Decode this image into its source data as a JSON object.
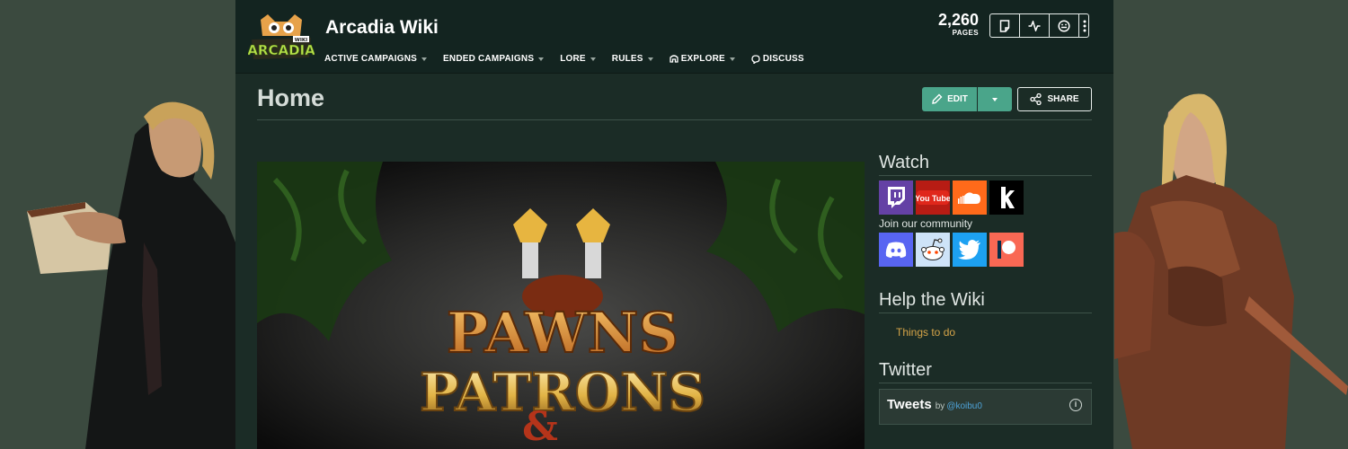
{
  "site": {
    "title": "Arcadia Wiki",
    "logo_text": "ARCADIA",
    "logo_badge": "WIKI",
    "pages_count": "2,260",
    "pages_label": "PAGES"
  },
  "nav": {
    "items": [
      {
        "label": "ACTIVE CAMPAIGNS",
        "icon": null
      },
      {
        "label": "ENDED CAMPAIGNS",
        "icon": null
      },
      {
        "label": "LORE",
        "icon": null
      },
      {
        "label": "RULES",
        "icon": null
      },
      {
        "label": "EXPLORE",
        "icon": "explore-icon"
      },
      {
        "label": "DISCUSS",
        "icon": "discuss-icon"
      }
    ]
  },
  "toolbar": {
    "icons": [
      "new-page-icon",
      "activity-icon",
      "face-icon",
      "more-icon"
    ]
  },
  "page": {
    "title": "Home",
    "edit_label": "EDIT",
    "share_label": "SHARE"
  },
  "banner": {
    "line1": "PAWNS",
    "line2": "PATRONS",
    "amp": "&"
  },
  "sidebar": {
    "watch_heading": "Watch",
    "watch_icons": [
      "twitch-icon",
      "youtube-icon",
      "soundcloud-icon",
      "kick-icon"
    ],
    "youtube_text": "You Tube",
    "community_text": "Join our community",
    "community_icons": [
      "discord-icon",
      "reddit-icon",
      "twitter-icon",
      "patreon-icon"
    ],
    "help_heading": "Help the Wiki",
    "help_link": "Things to do",
    "twitter_heading": "Twitter",
    "tweets_title": "Tweets",
    "tweets_by": "by",
    "tweets_handle": "@koibu0",
    "info_glyph": "i"
  },
  "colors": {
    "accent": "#4aa58a",
    "link": "#d5a448",
    "page_bg": "#1b2c26",
    "header_bg": "#132420",
    "outer_bg": "#3b4a3f"
  }
}
